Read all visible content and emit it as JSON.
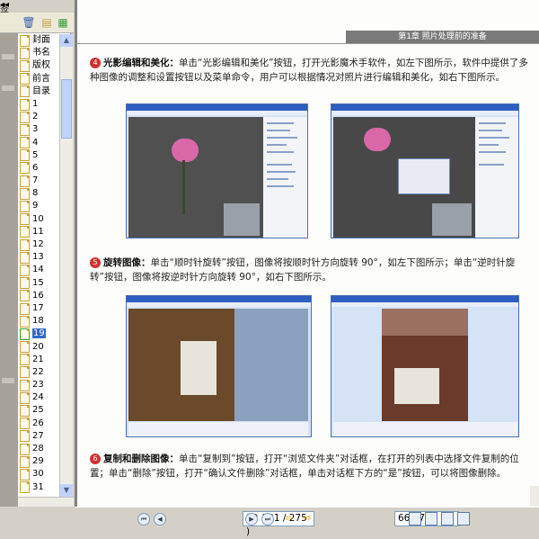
{
  "nav": {
    "title": "签",
    "collapse_glyph": "◂◂",
    "tools": [
      "delete-icon",
      "bookmark-new-icon",
      "bookmark-properties-icon"
    ],
    "bookmarks": [
      "封面",
      "书名",
      "版权",
      "前言",
      "目录",
      "1",
      "2",
      "3",
      "4",
      "5",
      "6",
      "7",
      "8",
      "9",
      "10",
      "11",
      "12",
      "13",
      "14",
      "15",
      "16",
      "17",
      "18",
      "19",
      "20",
      "21",
      "22",
      "23",
      "24",
      "25",
      "26",
      "27",
      "28",
      "29",
      "30",
      "31"
    ],
    "selected_bookmark": "19"
  },
  "document": {
    "chapter_header": "第1章 照片处理前的准备",
    "section4": {
      "num": "4",
      "title": "光影编辑和美化：",
      "body": "单击“光影编辑和美化”按钮，打开光影魔术手软件，如左下图所示，软件中提供了多种图像的调整和设置按钮以及菜单命令，用户可以根据情况对照片进行编辑和美化，如右下图所示。"
    },
    "section5": {
      "num": "5",
      "title": "旋转图像：",
      "body": "单击“顺时针旋转”按钮，图像将按顺时针方向旋转 90°，如左下图所示；单击“逆时针旋转”按钮，图像将按逆时针方向旋转 90°，如右下图所示。"
    },
    "section6": {
      "num": "6",
      "title": "复制和删除图像：",
      "body": "单击“复制到”按钮，打开“浏览文件夹”对话框，在打开的列表中选择文件复制的位置；单击“删除”按钮，打开“确认文件删除”对话框，单击对话框下方的“是”按钮，可以将图像删除。"
    }
  },
  "statusbar": {
    "left_text": "",
    "page_field": "19 ( 31 / 275 )",
    "zoom_field": "66.67%",
    "icons": {
      "nav": [
        "first-page-icon",
        "previous-page-icon",
        "next-page-icon",
        "last-page-icon"
      ],
      "history": [
        "back-arrow-icon",
        "forward-arrow-icon"
      ],
      "view": [
        "single-page-icon",
        "continuous-page-icon",
        "facing-page-icon",
        "continuous-facing-icon"
      ]
    }
  },
  "colors": {
    "accent": "#316ac5",
    "section_badge": "#d23030"
  }
}
